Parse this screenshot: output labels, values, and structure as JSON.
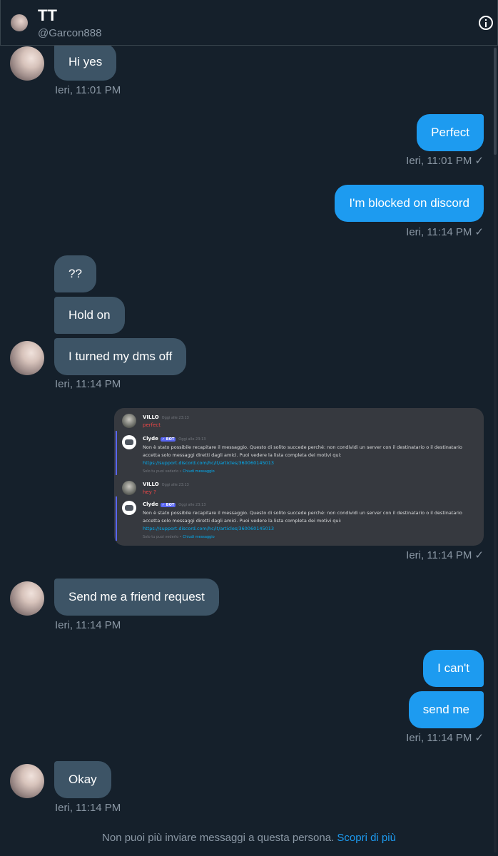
{
  "header": {
    "name": "TT",
    "handle": "@Garcon888"
  },
  "messages": [
    {
      "text": "Hi yes",
      "time": "Ieri, 11:01 PM"
    },
    {
      "text": "Perfect",
      "time": "Ieri, 11:01 PM"
    },
    {
      "text": "I'm blocked on discord",
      "time": "Ieri, 11:14 PM"
    },
    {
      "text": "??"
    },
    {
      "text": "Hold on"
    },
    {
      "text": "I turned my dms off",
      "time": "Ieri, 11:14 PM"
    },
    {
      "time": "Ieri, 11:14 PM"
    },
    {
      "text": "Send me a friend request",
      "time": "Ieri, 11:14 PM"
    },
    {
      "text": "I can't"
    },
    {
      "text": "send me",
      "time": "Ieri, 11:14 PM"
    },
    {
      "text": "Okay",
      "time": "Ieri, 11:14 PM"
    }
  ],
  "check_mark": "✓",
  "media": {
    "user_name": "VILLO",
    "time1": "Oggi alle 23:13",
    "msg1": "perfect",
    "bot_name": "Clyde",
    "bot_badge": "✓ BOT",
    "bot_time": "Oggi alle 23:13",
    "bot_text": "Non è stato possibile recapitare il messaggio. Questo di solito succede perché: non condividi un server con il destinatario o il destinatario accetta solo messaggi diretti dagli amici. Puoi vedere la lista completa dei motivi qui:",
    "bot_link": "https://support.discord.com/hc/it/articles/360060145013",
    "foot_text": "Solo tu puoi vederlo •",
    "foot_link": "Chiudi messaggio",
    "time2": "Oggi alle 23:13",
    "msg2": "hey ?"
  },
  "footer": {
    "text": "Non puoi più inviare messaggi a questa persona.",
    "link": "Scopri di più"
  }
}
